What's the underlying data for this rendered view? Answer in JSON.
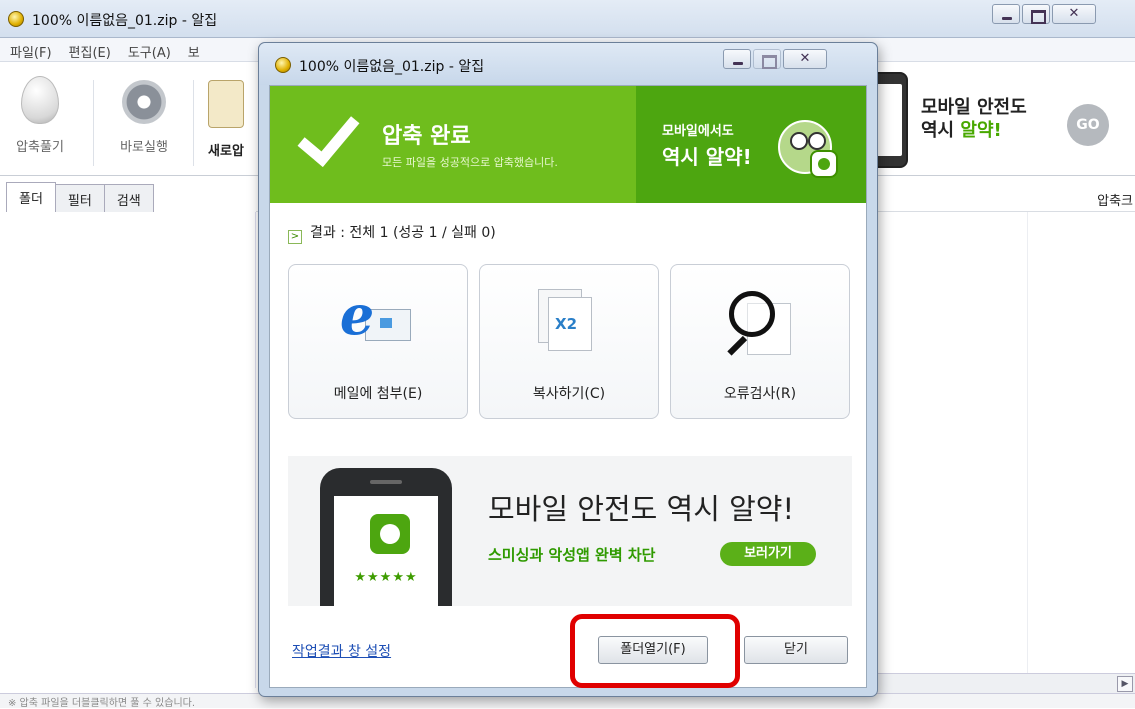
{
  "main_window": {
    "title": "100% 이름없음_01.zip - 알집",
    "menu": [
      "파일(F)",
      "편집(E)",
      "도구(A)",
      "보"
    ],
    "toolbar": {
      "extract_label": "압축풀기",
      "run_label": "바로실행",
      "new_label": "새로압"
    },
    "ad": {
      "line1": "모바일 안전도",
      "line2_prefix": "역시 ",
      "line2_highlight": "알약!",
      "go_label": "GO"
    },
    "tabs": [
      "폴더",
      "필터",
      "검색"
    ],
    "column_header": "압축크",
    "status_text": "※ 압축 파일을 더블클릭하면 풀 수 있습니다."
  },
  "dialog": {
    "title": "100% 이름없음_01.zip - 알집",
    "banner": {
      "heading": "압축 완료",
      "subtitle": "모든 파일을 성공적으로 압축했습니다.",
      "promo_line1": "모바일에서도",
      "promo_line2": "역시 알약!"
    },
    "result_text": "결과 : 전체 1 (성공 1 / 실패 0)",
    "actions": [
      {
        "label": "메일에 첨부(E)",
        "icon": "ie-mail-icon"
      },
      {
        "label": "복사하기(C)",
        "icon": "copy-x2-icon",
        "badge": "X2"
      },
      {
        "label": "오류검사(R)",
        "icon": "magnifier-icon"
      }
    ],
    "ad": {
      "headline": "모바일 안전도 역시 알약!",
      "subline": "스미싱과 악성앱 완벽 차단",
      "button_label": "보러가기",
      "stars": "★★★★★"
    },
    "settings_link": "작업결과 창 설정",
    "open_folder_label": "폴더열기(F)",
    "close_label": "닫기"
  },
  "colors": {
    "banner_green": "#6fbd1d",
    "banner_dark_green": "#4da610",
    "highlight_red": "#e00000",
    "link_blue": "#1e4fb5"
  }
}
